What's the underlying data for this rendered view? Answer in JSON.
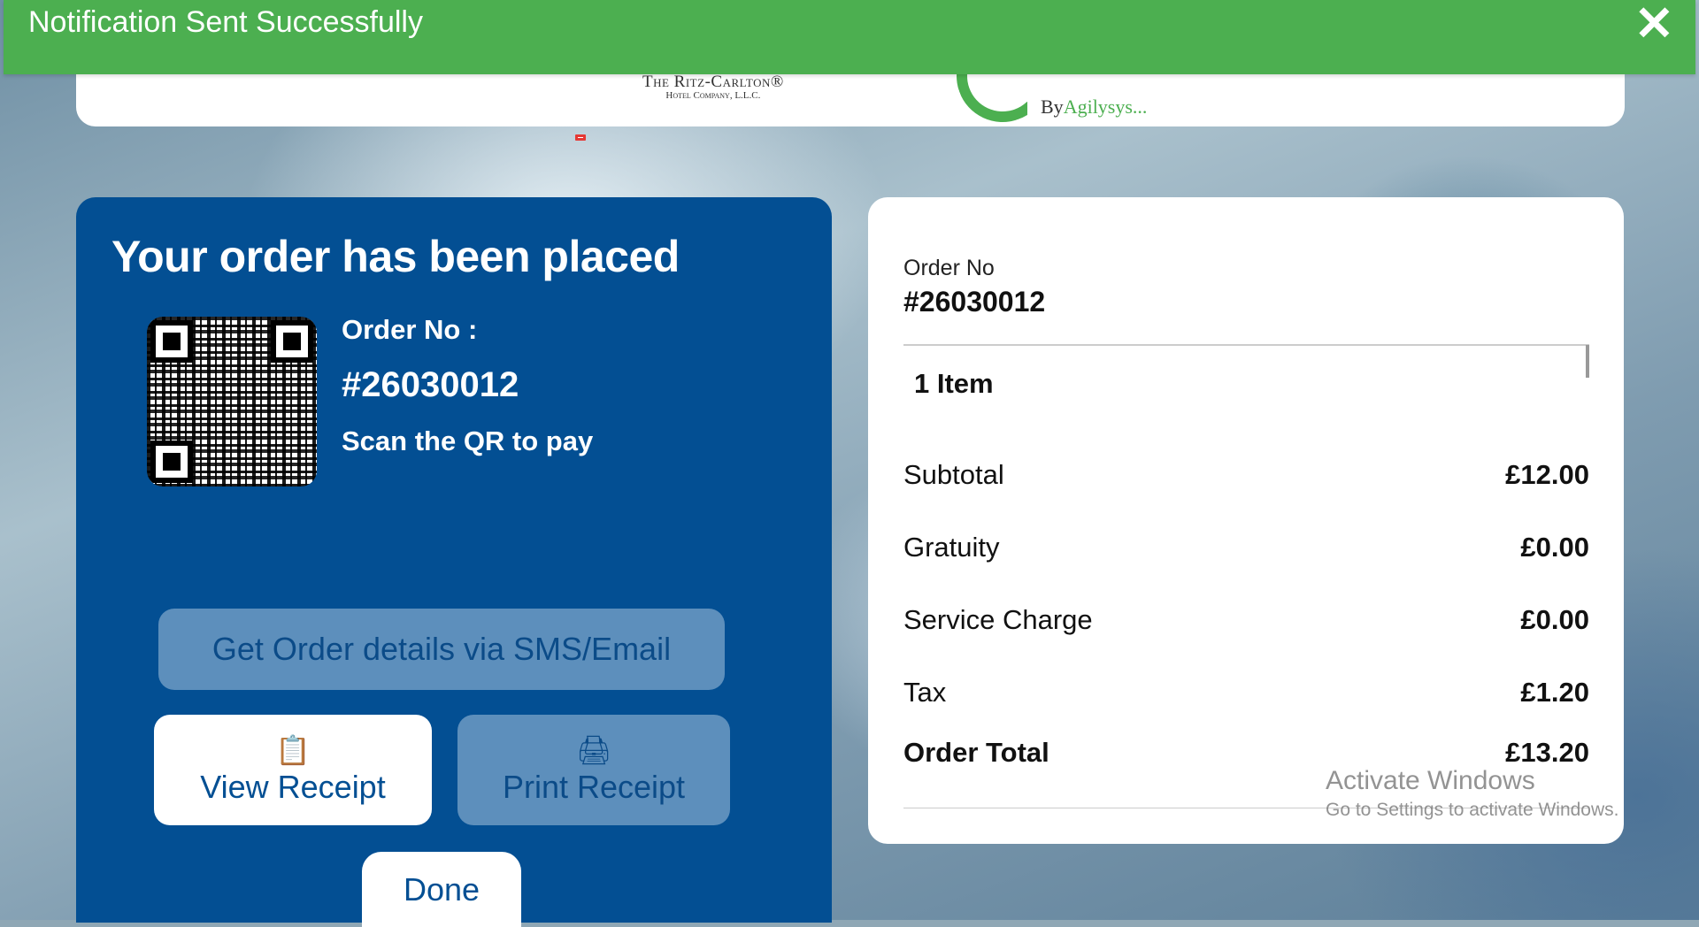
{
  "notification": {
    "message": "Notification Sent Successfully",
    "close_icon": "✕"
  },
  "header": {
    "logo_ritz_line1": "The Ritz-Carlton®",
    "logo_ritz_line2": "Hotel Company, L.L.C.",
    "logo_by": "By",
    "logo_agilysys": "Agilysys..."
  },
  "left": {
    "title": "Your order has been placed",
    "order_label": "Order No :",
    "order_number": "#26030012",
    "scan_text": "Scan the QR to pay",
    "sms_button": "Get Order details via SMS/Email",
    "view_receipt": "View Receipt",
    "print_receipt": "Print Receipt",
    "done": "Done"
  },
  "right": {
    "order_label": "Order No",
    "order_number": "#26030012",
    "items": "1 Item",
    "rows": [
      {
        "label": "Subtotal",
        "value": "£12.00"
      },
      {
        "label": "Gratuity",
        "value": "£0.00"
      },
      {
        "label": "Service Charge",
        "value": "£0.00"
      },
      {
        "label": "Tax",
        "value": "£1.20"
      },
      {
        "label": "Order Total",
        "value": "£13.20"
      }
    ]
  },
  "watermark": {
    "line1": "Activate Windows",
    "line2": "Go to Settings to activate Windows."
  },
  "colors": {
    "notification": "#4caf50",
    "panel_blue": "#034f93",
    "button_light": "#5d8fbc"
  }
}
